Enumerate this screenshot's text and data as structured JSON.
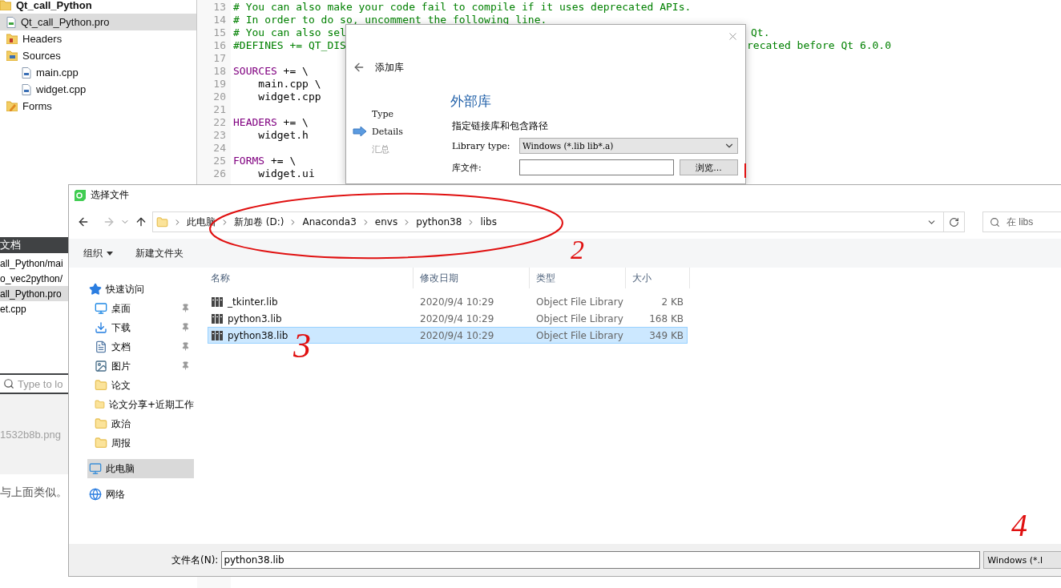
{
  "project_tree": {
    "items": [
      {
        "label": "Qt_call_Python",
        "kind": "project",
        "selected": false,
        "children": [
          {
            "label": "Qt_call_Python.pro",
            "kind": "pro",
            "selected": true
          },
          {
            "label": "Headers",
            "kind": "headers",
            "selected": false
          },
          {
            "label": "Sources",
            "kind": "sources",
            "selected": false,
            "children": [
              {
                "label": "main.cpp",
                "kind": "cpp",
                "selected": false
              },
              {
                "label": "widget.cpp",
                "kind": "cpp",
                "selected": false
              }
            ]
          },
          {
            "label": "Forms",
            "kind": "forms",
            "selected": false
          }
        ]
      }
    ]
  },
  "documents": {
    "title": "文档",
    "items": [
      {
        "label": "all_Python/mai",
        "selected": false
      },
      {
        "label": "o_vec2python/",
        "selected": false
      },
      {
        "label": "all_Python.pro",
        "selected": true
      },
      {
        "label": "et.cpp",
        "selected": false
      }
    ]
  },
  "locator": {
    "placeholder": "Type to lo"
  },
  "page_behind": {
    "filename": "1532b8b.png",
    "text": "与上面类似。"
  },
  "editor": {
    "lines": [
      {
        "number": "13",
        "kind": "comment",
        "text": "# You can also make your code fail to compile if it uses deprecated APIs."
      },
      {
        "number": "14",
        "kind": "comment",
        "text": "# In order to do so, uncomment the following line."
      },
      {
        "number": "15",
        "kind": "comment",
        "text": "# You can also sel",
        "tail": "Qt."
      },
      {
        "number": "16",
        "kind": "comment",
        "text": "#DEFINES += QT_DIS",
        "tail": "recated before Qt 6.0.0"
      },
      {
        "number": "17",
        "kind": "blank"
      },
      {
        "number": "18",
        "kind": "assign",
        "keyword": "SOURCES",
        "text": " += \\"
      },
      {
        "number": "19",
        "kind": "plain",
        "text": "    main.cpp \\"
      },
      {
        "number": "20",
        "kind": "plain",
        "text": "    widget.cpp"
      },
      {
        "number": "21",
        "kind": "blank"
      },
      {
        "number": "22",
        "kind": "assign",
        "keyword": "HEADERS",
        "text": " += \\"
      },
      {
        "number": "23",
        "kind": "plain",
        "text": "    widget.h"
      },
      {
        "number": "24",
        "kind": "blank"
      },
      {
        "number": "25",
        "kind": "assign",
        "keyword": "FORMS",
        "text": " += \\"
      },
      {
        "number": "26",
        "kind": "plain",
        "text": "    widget.ui"
      }
    ]
  },
  "wizard": {
    "title": "添加库",
    "steps": [
      {
        "label": "Type",
        "current": false,
        "disabled": false
      },
      {
        "label": "Details",
        "current": true,
        "disabled": false
      },
      {
        "label": "汇总",
        "current": false,
        "disabled": true
      }
    ],
    "heading": "外部库",
    "subtitle": "指定链接库和包含路径",
    "library_type": {
      "label": "Library type:",
      "value": "Windows (*.lib lib*.a)"
    },
    "library_file": {
      "label": "库文件:"
    },
    "browse": "浏览..."
  },
  "file_dialog": {
    "title": "选择文件",
    "path": [
      "此电脑",
      "新加卷 (D:)",
      "Anaconda3",
      "envs",
      "python38",
      "libs"
    ],
    "search": {
      "placeholder": "在 libs"
    },
    "toolbar": [
      {
        "label": "组织",
        "menu": true
      },
      {
        "label": "新建文件夹",
        "menu": false
      }
    ],
    "nav": [
      {
        "label": "快速访问",
        "kind": "quick",
        "pinned": false,
        "selected": false
      },
      {
        "label": "桌面",
        "kind": "desktop",
        "pinned": true,
        "selected": false
      },
      {
        "label": "下载",
        "kind": "download",
        "pinned": true,
        "selected": false
      },
      {
        "label": "文档",
        "kind": "docs",
        "pinned": true,
        "selected": false
      },
      {
        "label": "图片",
        "kind": "pictures",
        "pinned": true,
        "selected": false
      },
      {
        "label": "论文",
        "kind": "folder",
        "pinned": false,
        "selected": false
      },
      {
        "label": "论文分享+近期工作",
        "kind": "folder",
        "pinned": false,
        "selected": false
      },
      {
        "label": "政治",
        "kind": "folder",
        "pinned": false,
        "selected": false
      },
      {
        "label": "周报",
        "kind": "folder",
        "pinned": false,
        "selected": false
      },
      {
        "label": "此电脑",
        "kind": "pc",
        "pinned": false,
        "selected": true
      },
      {
        "label": "网络",
        "kind": "network",
        "pinned": false,
        "selected": false
      }
    ],
    "columns": [
      "名称",
      "修改日期",
      "类型",
      "大小"
    ],
    "rows": [
      {
        "name": "_tkinter.lib",
        "modified": "2020/9/4 10:29",
        "type": "Object File Library",
        "size": "2 KB",
        "selected": false
      },
      {
        "name": "python3.lib",
        "modified": "2020/9/4 10:29",
        "type": "Object File Library",
        "size": "168 KB",
        "selected": false
      },
      {
        "name": "python38.lib",
        "modified": "2020/9/4 10:29",
        "type": "Object File Library",
        "size": "349 KB",
        "selected": true
      }
    ],
    "filename_label": "文件名(N):",
    "filename": "python38.lib",
    "filter": "Windows (*.l"
  },
  "annotations": [
    {
      "text": "2"
    },
    {
      "text": "3"
    },
    {
      "text": "4"
    }
  ]
}
